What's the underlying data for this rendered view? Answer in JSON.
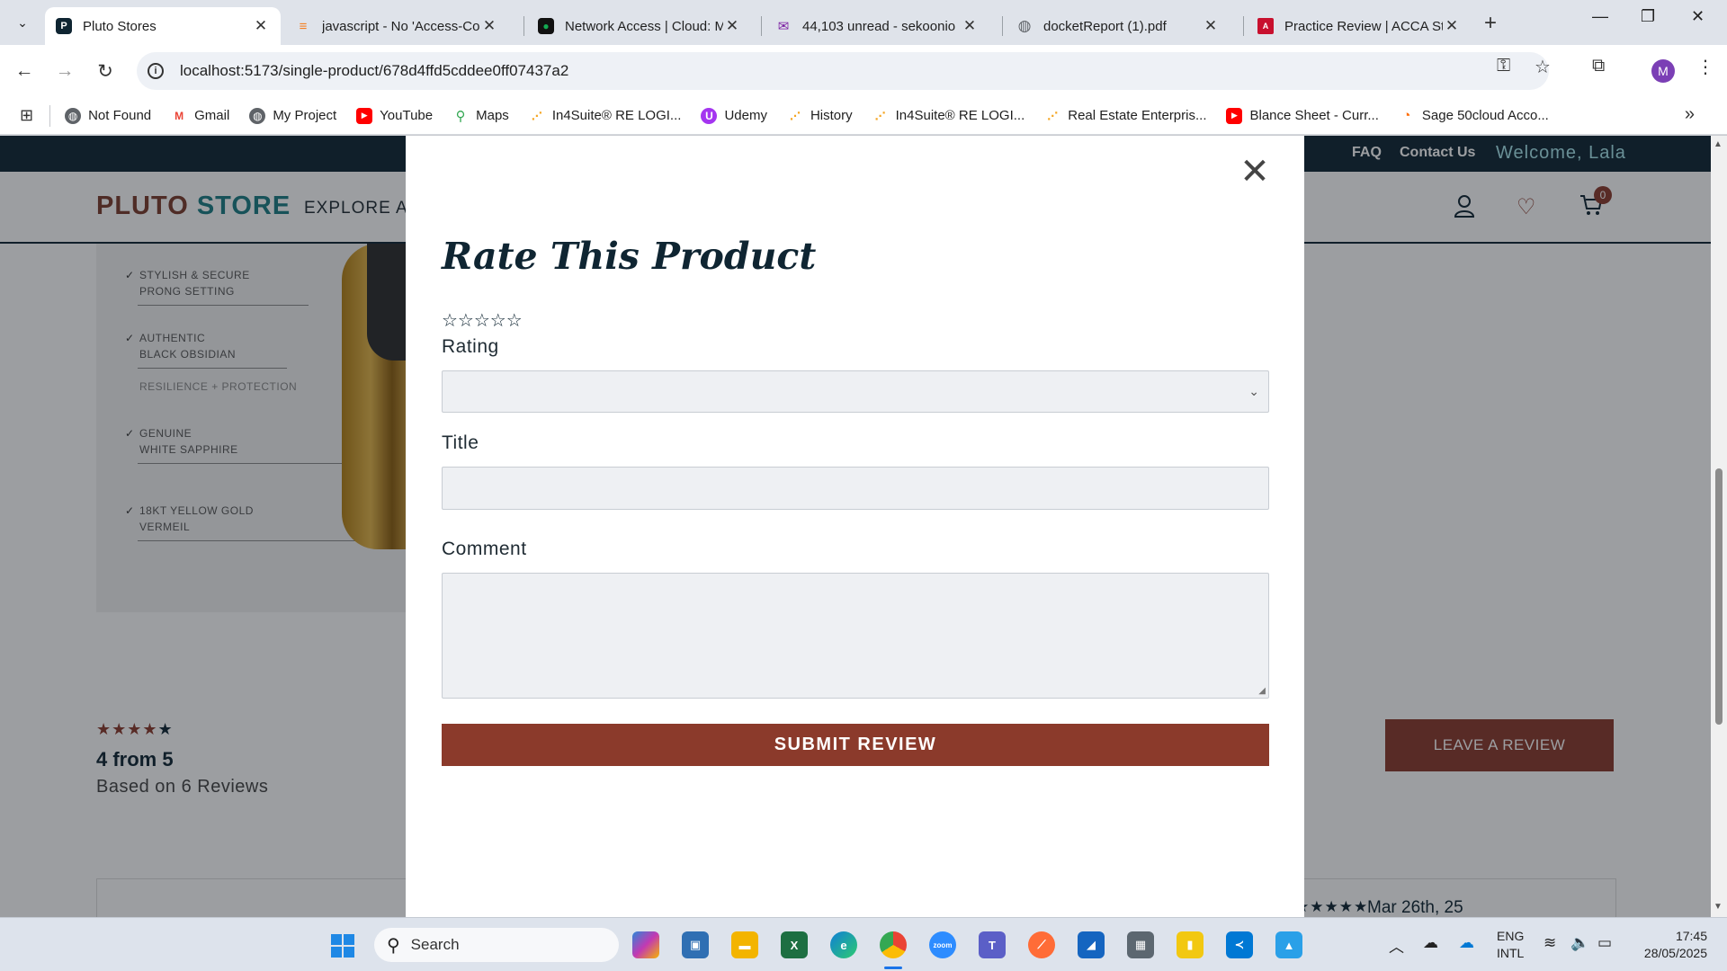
{
  "browser": {
    "tabs": [
      {
        "title": "Pluto Stores",
        "active": true,
        "favicon": "P",
        "favicon_color": "#0f2532"
      },
      {
        "title": "javascript - No 'Access-Co",
        "active": false,
        "favicon": "≡",
        "favicon_color": "#f48024"
      },
      {
        "title": "Network Access | Cloud: M",
        "active": false,
        "favicon": "●",
        "favicon_color": "#13aa52"
      },
      {
        "title": "44,103 unread - sekoonio",
        "active": false,
        "favicon": "✉",
        "favicon_color": "#7b1fa2"
      },
      {
        "title": "docketReport (1).pdf",
        "active": false,
        "favicon": "◍",
        "favicon_color": "#5f6368"
      },
      {
        "title": "Practice Review | ACCA Stu",
        "active": false,
        "favicon": "A",
        "favicon_color": "#c8102e"
      }
    ],
    "url": "localhost:5173/single-product/678d4ffd5cddee0ff07437a2",
    "profile_initial": "M",
    "bookmarks": [
      {
        "label": "Not Found",
        "icon": "globe-icon"
      },
      {
        "label": "Gmail",
        "icon": "gmail-icon"
      },
      {
        "label": "My Project",
        "icon": "globe-icon"
      },
      {
        "label": "YouTube",
        "icon": "youtube-icon"
      },
      {
        "label": "Maps",
        "icon": "maps-icon"
      },
      {
        "label": "In4Suite® RE LOGI...",
        "icon": "in4suite-icon"
      },
      {
        "label": "Udemy",
        "icon": "udemy-icon"
      },
      {
        "label": "History",
        "icon": "in4suite-icon"
      },
      {
        "label": "In4Suite® RE LOGI...",
        "icon": "in4suite-icon"
      },
      {
        "label": "Real Estate Enterpris...",
        "icon": "in4suite-icon"
      },
      {
        "label": "Blance Sheet - Curr...",
        "icon": "youtube-icon"
      },
      {
        "label": "Sage 50cloud Acco...",
        "icon": "sage-icon"
      }
    ]
  },
  "site": {
    "topbar": {
      "faq": "FAQ",
      "contact": "Contact Us",
      "welcome": "Welcome, Lala"
    },
    "logo_part1": "PLUTO",
    "logo_part2": "STORE",
    "nav_explore": "EXPLORE AL",
    "cart_count": "0",
    "features": [
      {
        "line1": "STYLISH & SECURE",
        "line2": "PRONG SETTING"
      },
      {
        "line1": "AUTHENTIC",
        "line2": "BLACK OBSIDIAN"
      },
      {
        "line1": "RESILIENCE + PROTECTION",
        "line2": ""
      },
      {
        "line1": "GENUINE",
        "line2": "WHITE SAPPHIRE"
      },
      {
        "line1": "18KT YELLOW GOLD",
        "line2": "VERMEIL"
      }
    ],
    "rating_summary": {
      "stars": 4,
      "average_text": "4 from 5",
      "count_text": "Based on 6 Reviews"
    },
    "leave_review_label": "LEAVE A REVIEW",
    "first_review_date": "Mar 26th, 25",
    "first_review_stars": 5
  },
  "modal": {
    "title": "Rate This Product",
    "stars_display": "☆☆☆☆☆",
    "rating_label": "Rating",
    "rating_value": "",
    "title_label": "Title",
    "title_value": "",
    "comment_label": "Comment",
    "comment_value": "",
    "submit_label": "SUBMIT REVIEW"
  },
  "taskbar": {
    "search_placeholder": "Search",
    "lang_line1": "ENG",
    "lang_line2": "INTL",
    "time": "17:45",
    "date": "28/05/2025"
  },
  "colors": {
    "brand_dark": "#0f2532",
    "brand_accent": "#8b3a2b",
    "brand_teal": "#1a7d84"
  }
}
